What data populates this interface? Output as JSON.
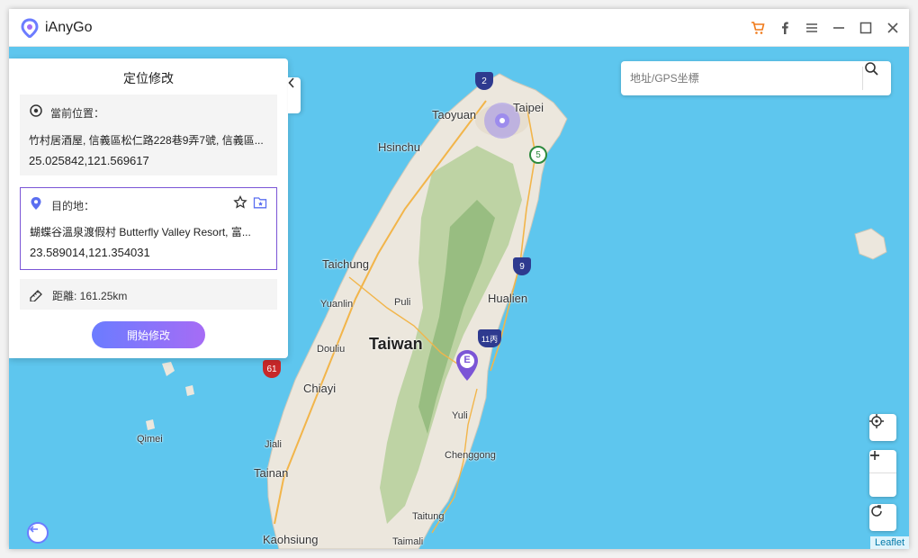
{
  "app": {
    "title": "iAnyGo"
  },
  "panel": {
    "title": "定位修改",
    "current": {
      "label": "當前位置：",
      "address": "竹村居酒屋, 信義區松仁路228巷9弄7號, 信義區...",
      "coords": "25.025842,121.569617"
    },
    "destination": {
      "label": "目的地：",
      "address": "蝴蝶谷溫泉渡假村 Butterfly Valley Resort, 富...",
      "coords": "23.589014,121.354031"
    },
    "distance": {
      "text": "距離: 161.25km"
    },
    "start_button": "開始修改"
  },
  "search": {
    "placeholder": "地址/GPS坐標"
  },
  "map": {
    "labels": {
      "taipei": "Taipei",
      "taoyuan": "Taoyuan",
      "hsinchu": "Hsinchu",
      "taichung": "Taichung",
      "puli": "Puli",
      "yuanlin": "Yuanlin",
      "hualien": "Hualien",
      "taiwan": "Taiwan",
      "douliu": "Douliu",
      "chiayi": "Chiayi",
      "yuli": "Yuli",
      "qimei": "Qimei",
      "jiali": "Jiali",
      "tainan": "Tainan",
      "chenggong": "Chenggong",
      "taitung": "Taitung",
      "kaohsiung": "Kaohsiung",
      "taimali": "Taimali"
    },
    "road_shields": {
      "r2": "2",
      "r5": "5",
      "r9": "9",
      "r11": "11丙",
      "r61": "61"
    },
    "destination_marker": "E",
    "attribution": "Leaflet"
  },
  "colors": {
    "accent": "#7b55d6",
    "sea": "#5ec6ee",
    "cart": "#f07a1a"
  }
}
